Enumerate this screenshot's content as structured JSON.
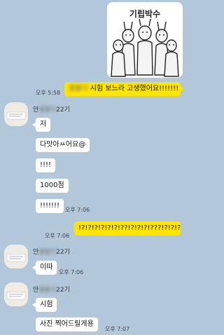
{
  "sticker": {
    "caption": "기립박수",
    "icon": "standing-ovation-sticker"
  },
  "me1": {
    "blurred_prefix": "셀블디",
    "text": " 시험 보느라 고생했어요!!!!!!!",
    "time": "오후 5:58"
  },
  "sender1": {
    "name_prefix": "안",
    "name_blurred": "셀블디",
    "name_suffix": "22기",
    "messages": [
      "저",
      "다맛아ㅆ어요@",
      "!!!!",
      "1000점",
      "!!!!!!!"
    ],
    "time": "오후 7:06"
  },
  "me2": {
    "text": "!?!?!?!?!?!?!??!?!?!?!???!?!?!?!?!",
    "time": "오후 7:06"
  },
  "sender2": {
    "name_prefix": "안",
    "name_blurred": "셀블디",
    "name_suffix": "22기",
    "messages": [
      "이따"
    ],
    "time": "오후 7:06"
  },
  "sender3": {
    "name_prefix": "안",
    "name_blurred": "셀블디",
    "name_suffix": "22기",
    "messages": [
      "시험",
      "사진 찍어드릴게용"
    ],
    "time": "오후 7:07"
  },
  "colors": {
    "background": "#b2c7da",
    "my_bubble": "#fee500",
    "their_bubble": "#ffffff"
  }
}
